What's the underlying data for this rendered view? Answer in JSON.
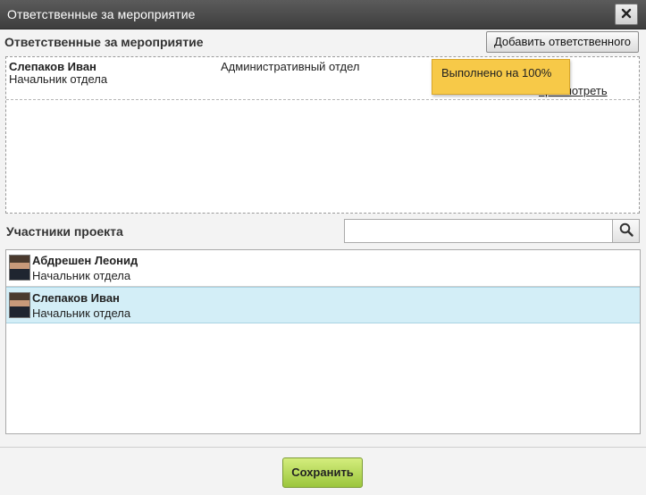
{
  "window": {
    "title": "Ответственные за мероприятие"
  },
  "responsible": {
    "heading": "Ответственные за мероприятие",
    "add_button": "Добавить ответственного",
    "entries": [
      {
        "name": "Слепаков Иван",
        "position": "Начальник отдела",
        "department": "Административный отдел",
        "status": "Выполнено на 100%",
        "status_percent": 100,
        "view_link": "просмотреть"
      }
    ]
  },
  "participants": {
    "heading": "Участники проекта",
    "search_placeholder": "",
    "members": [
      {
        "name": "Абдрешен Леонид",
        "position": "Начальник отдела",
        "selected": false
      },
      {
        "name": "Слепаков Иван",
        "position": "Начальник отдела",
        "selected": true
      }
    ]
  },
  "footer": {
    "save_button": "Сохранить"
  },
  "icons": {
    "close": "close-icon",
    "search": "search-icon"
  },
  "colors": {
    "titlebar": "#4a4a4a",
    "sticky": "#f7c948",
    "selected_row": "#d3eef7",
    "save_button": "#a8d14a"
  }
}
